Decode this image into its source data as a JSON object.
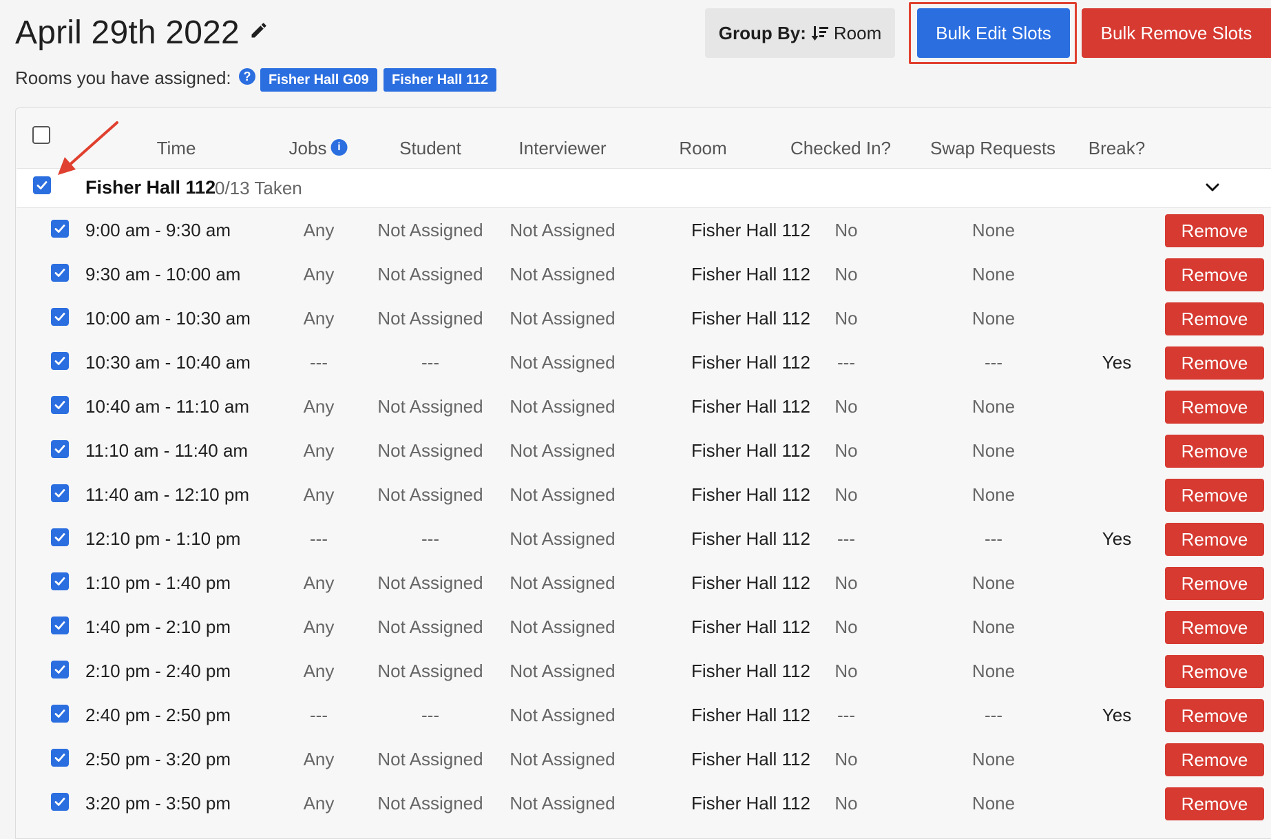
{
  "page": {
    "title": "April 29th 2022",
    "rooms_label": "Rooms you have assigned:",
    "rooms": [
      "Fisher Hall G09",
      "Fisher Hall 112"
    ]
  },
  "toolbar": {
    "group_by_label": "Group By:",
    "group_by_value": "Room",
    "bulk_edit_label": "Bulk Edit Slots",
    "bulk_remove_label": "Bulk Remove Slots"
  },
  "colors": {
    "primary": "#2b6ee0",
    "danger": "#d63a31",
    "highlight": "#e0402f"
  },
  "table": {
    "headers": {
      "time": "Time",
      "jobs": "Jobs",
      "student": "Student",
      "interviewer": "Interviewer",
      "room": "Room",
      "checked_in": "Checked In?",
      "swap_requests": "Swap Requests",
      "break": "Break?"
    },
    "group": {
      "name": "Fisher Hall 112",
      "taken": "0/13 Taken",
      "checked": true
    },
    "remove_label": "Remove",
    "rows": [
      {
        "time": "9:00 am - 9:30 am",
        "jobs": "Any",
        "student": "Not Assigned",
        "interviewer": "Not Assigned",
        "room": "Fisher Hall 112",
        "checked_in": "No",
        "swap": "None",
        "break": ""
      },
      {
        "time": "9:30 am - 10:00 am",
        "jobs": "Any",
        "student": "Not Assigned",
        "interviewer": "Not Assigned",
        "room": "Fisher Hall 112",
        "checked_in": "No",
        "swap": "None",
        "break": ""
      },
      {
        "time": "10:00 am - 10:30 am",
        "jobs": "Any",
        "student": "Not Assigned",
        "interviewer": "Not Assigned",
        "room": "Fisher Hall 112",
        "checked_in": "No",
        "swap": "None",
        "break": ""
      },
      {
        "time": "10:30 am - 10:40 am",
        "jobs": "---",
        "student": "---",
        "interviewer": "Not Assigned",
        "room": "Fisher Hall 112",
        "checked_in": "---",
        "swap": "---",
        "break": "Yes"
      },
      {
        "time": "10:40 am - 11:10 am",
        "jobs": "Any",
        "student": "Not Assigned",
        "interviewer": "Not Assigned",
        "room": "Fisher Hall 112",
        "checked_in": "No",
        "swap": "None",
        "break": ""
      },
      {
        "time": "11:10 am - 11:40 am",
        "jobs": "Any",
        "student": "Not Assigned",
        "interviewer": "Not Assigned",
        "room": "Fisher Hall 112",
        "checked_in": "No",
        "swap": "None",
        "break": ""
      },
      {
        "time": "11:40 am - 12:10 pm",
        "jobs": "Any",
        "student": "Not Assigned",
        "interviewer": "Not Assigned",
        "room": "Fisher Hall 112",
        "checked_in": "No",
        "swap": "None",
        "break": ""
      },
      {
        "time": "12:10 pm - 1:10 pm",
        "jobs": "---",
        "student": "---",
        "interviewer": "Not Assigned",
        "room": "Fisher Hall 112",
        "checked_in": "---",
        "swap": "---",
        "break": "Yes"
      },
      {
        "time": "1:10 pm - 1:40 pm",
        "jobs": "Any",
        "student": "Not Assigned",
        "interviewer": "Not Assigned",
        "room": "Fisher Hall 112",
        "checked_in": "No",
        "swap": "None",
        "break": ""
      },
      {
        "time": "1:40 pm - 2:10 pm",
        "jobs": "Any",
        "student": "Not Assigned",
        "interviewer": "Not Assigned",
        "room": "Fisher Hall 112",
        "checked_in": "No",
        "swap": "None",
        "break": ""
      },
      {
        "time": "2:10 pm - 2:40 pm",
        "jobs": "Any",
        "student": "Not Assigned",
        "interviewer": "Not Assigned",
        "room": "Fisher Hall 112",
        "checked_in": "No",
        "swap": "None",
        "break": ""
      },
      {
        "time": "2:40 pm - 2:50 pm",
        "jobs": "---",
        "student": "---",
        "interviewer": "Not Assigned",
        "room": "Fisher Hall 112",
        "checked_in": "---",
        "swap": "---",
        "break": "Yes"
      },
      {
        "time": "2:50 pm - 3:20 pm",
        "jobs": "Any",
        "student": "Not Assigned",
        "interviewer": "Not Assigned",
        "room": "Fisher Hall 112",
        "checked_in": "No",
        "swap": "None",
        "break": ""
      },
      {
        "time": "3:20 pm - 3:50 pm",
        "jobs": "Any",
        "student": "Not Assigned",
        "interviewer": "Not Assigned",
        "room": "Fisher Hall 112",
        "checked_in": "No",
        "swap": "None",
        "break": ""
      }
    ]
  }
}
